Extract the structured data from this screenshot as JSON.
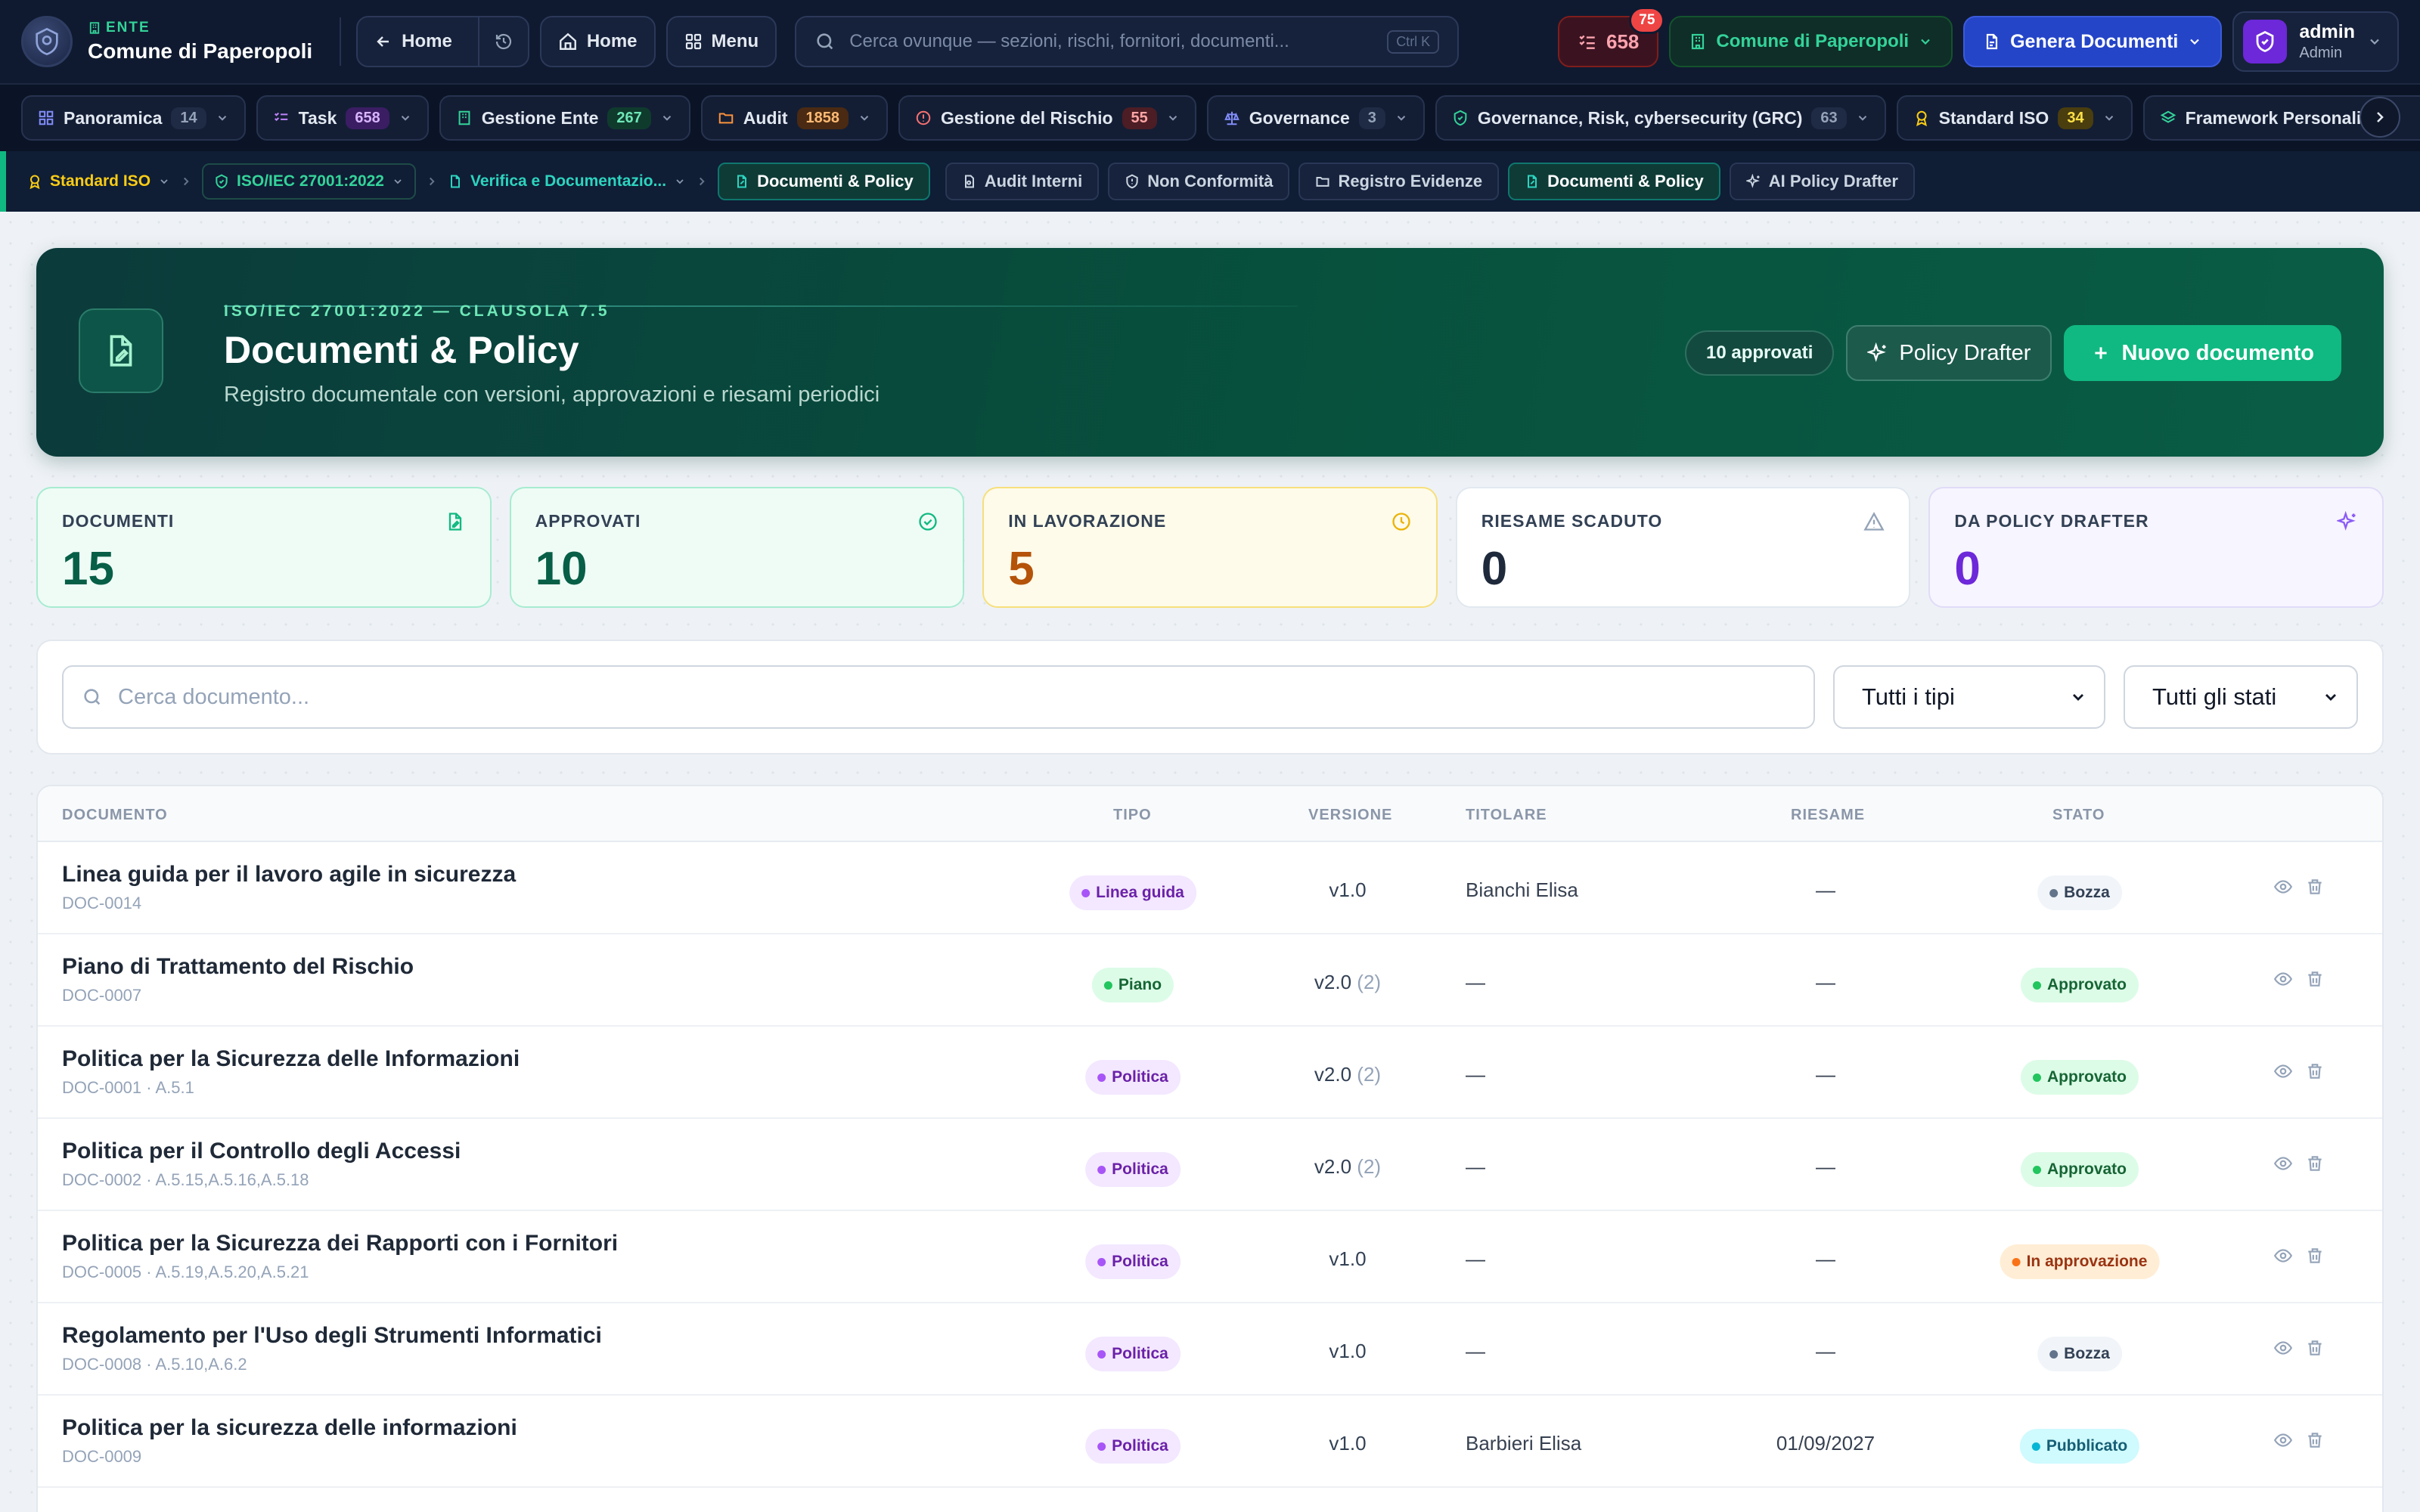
{
  "topbar": {
    "org_kicker": "ENTE",
    "org_name": "Comune di Paperopoli",
    "back_home": "Home",
    "home": "Home",
    "menu": "Menu",
    "search_placeholder": "Cerca ovunque — sezioni, rischi, fornitori, documenti...",
    "search_shortcut": "Ctrl K",
    "tasks_count": "658",
    "tasks_badge": "75",
    "org_selector": "Comune di Paperopoli",
    "generate": "Genera Documenti",
    "user_name": "admin",
    "user_role": "Admin"
  },
  "modules": [
    {
      "label": "Panoramica",
      "count": "14",
      "icon": "grid-icon"
    },
    {
      "label": "Task",
      "count": "658",
      "icon": "tasks-icon"
    },
    {
      "label": "Gestione Ente",
      "count": "267",
      "icon": "building-icon"
    },
    {
      "label": "Audit",
      "count": "1858",
      "icon": "folder-icon"
    },
    {
      "label": "Gestione del Rischio",
      "count": "55",
      "icon": "alert-icon"
    },
    {
      "label": "Governance",
      "count": "3",
      "icon": "scale-icon"
    },
    {
      "label": "Governance, Risk, cybersecurity (GRC)",
      "count": "63",
      "icon": "shield-icon"
    },
    {
      "label": "Standard ISO",
      "count": "34",
      "icon": "award-icon"
    },
    {
      "label": "Framework Personalizzati",
      "count": "",
      "icon": "layers-icon"
    }
  ],
  "breadcrumb": {
    "standard": "Standard ISO",
    "iso": "ISO/IEC 27001:2022",
    "section": "Verifica e Documentazio..."
  },
  "subnav": [
    "Documenti & Policy",
    "Audit Interni",
    "Non Conformità",
    "Registro Evidenze",
    "Documenti & Policy",
    "AI Policy Drafter"
  ],
  "hero": {
    "kicker": "ISO/IEC 27001:2022 — CLAUSOLA 7.5",
    "title": "Documenti & Policy",
    "subtitle": "Registro documentale con versioni, approvazioni e riesami periodici",
    "approved_pill": "10 approvati",
    "drafter_button": "Policy Drafter",
    "new_button": "Nuovo documento"
  },
  "stats": [
    {
      "label": "DOCUMENTI",
      "value": "15"
    },
    {
      "label": "APPROVATI",
      "value": "10"
    },
    {
      "label": "IN LAVORAZIONE",
      "value": "5"
    },
    {
      "label": "RIESAME SCADUTO",
      "value": "0"
    },
    {
      "label": "DA POLICY DRAFTER",
      "value": "0"
    }
  ],
  "filters": {
    "search_placeholder": "Cerca documento...",
    "type_selected": "Tutti i tipi",
    "status_selected": "Tutti gli stati"
  },
  "table": {
    "headers": {
      "documento": "DOCUMENTO",
      "tipo": "TIPO",
      "versione": "VERSIONE",
      "titolare": "TITOLARE",
      "riesame": "RIESAME",
      "stato": "STATO"
    },
    "rows": [
      {
        "title": "Linea guida per il lavoro agile in sicurezza",
        "code": "DOC-0014",
        "type": "Linea guida",
        "version": "v1.0",
        "rev": "",
        "owner": "Bianchi Elisa",
        "review": "—",
        "status": "Bozza"
      },
      {
        "title": "Piano di Trattamento del Rischio",
        "code": "DOC-0007",
        "type": "Piano",
        "version": "v2.0",
        "rev": "(2)",
        "owner": "—",
        "review": "—",
        "status": "Approvato"
      },
      {
        "title": "Politica per la Sicurezza delle Informazioni",
        "code": "DOC-0001 · A.5.1",
        "type": "Politica",
        "version": "v2.0",
        "rev": "(2)",
        "owner": "—",
        "review": "—",
        "status": "Approvato"
      },
      {
        "title": "Politica per il Controllo degli Accessi",
        "code": "DOC-0002 · A.5.15,A.5.16,A.5.18",
        "type": "Politica",
        "version": "v2.0",
        "rev": "(2)",
        "owner": "—",
        "review": "—",
        "status": "Approvato"
      },
      {
        "title": "Politica per la Sicurezza dei Rapporti con i Fornitori",
        "code": "DOC-0005 · A.5.19,A.5.20,A.5.21",
        "type": "Politica",
        "version": "v1.0",
        "rev": "",
        "owner": "—",
        "review": "—",
        "status": "In approvazione"
      },
      {
        "title": "Regolamento per l'Uso degli Strumenti Informatici",
        "code": "DOC-0008 · A.5.10,A.6.2",
        "type": "Politica",
        "version": "v1.0",
        "rev": "",
        "owner": "—",
        "review": "—",
        "status": "Bozza"
      },
      {
        "title": "Politica per la sicurezza delle informazioni",
        "code": "DOC-0009",
        "type": "Politica",
        "version": "v1.0",
        "rev": "",
        "owner": "Barbieri Elisa",
        "review": "01/09/2027",
        "status": "Pubblicato"
      }
    ]
  },
  "colors": {
    "accent": "#10b981",
    "hero_bg": "#07513d",
    "topbar_bg": "#0f1a30"
  }
}
